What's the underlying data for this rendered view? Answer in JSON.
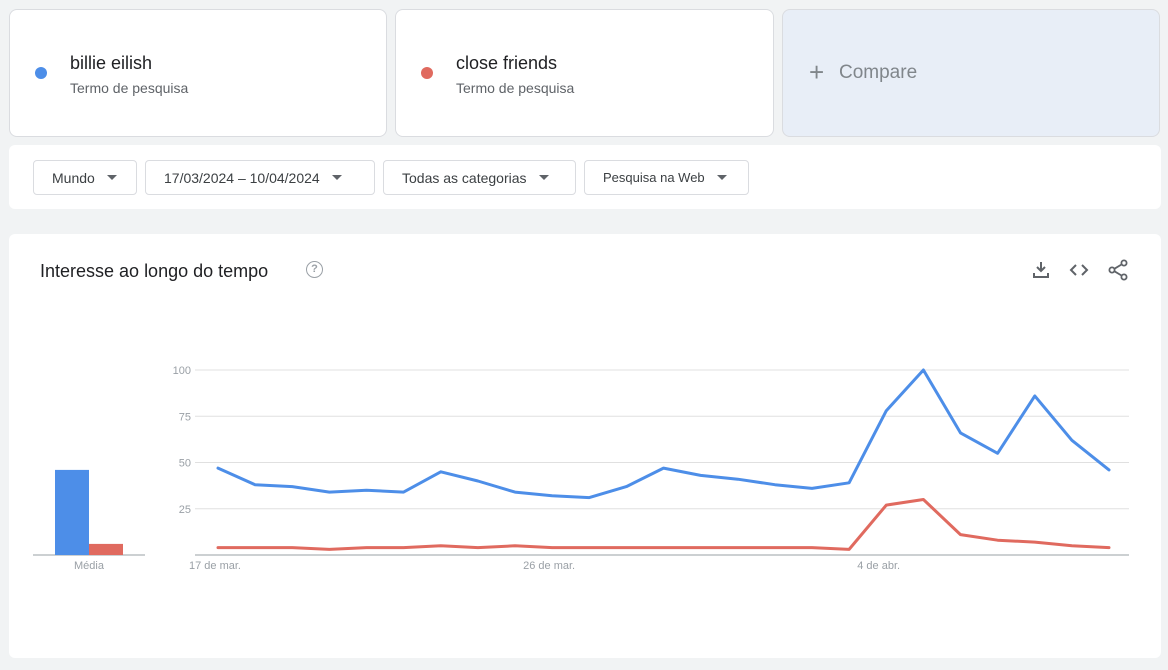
{
  "terms": [
    {
      "name": "billie eilish",
      "subtitle": "Termo de pesquisa",
      "color": "#4d8ee8"
    },
    {
      "name": "close friends",
      "subtitle": "Termo de pesquisa",
      "color": "#e06a5f"
    }
  ],
  "compare": {
    "icon": "+",
    "label": "Compare"
  },
  "filters": {
    "region": "Mundo",
    "date_range": "17/03/2024 – 10/04/2024",
    "category": "Todas as categorias",
    "search_type": "Pesquisa na Web"
  },
  "panel": {
    "title": "Interesse ao longo do tempo",
    "help_icon": "?",
    "actions": [
      "download-icon",
      "embed-icon",
      "share-icon"
    ]
  },
  "chart_data": {
    "type": "line",
    "x": [
      "17 de mar.",
      "18 de mar.",
      "19 de mar.",
      "20 de mar.",
      "21 de mar.",
      "22 de mar.",
      "23 de mar.",
      "24 de mar.",
      "25 de mar.",
      "26 de mar.",
      "27 de mar.",
      "28 de mar.",
      "29 de mar.",
      "30 de mar.",
      "31 de mar.",
      "1 de abr.",
      "2 de abr.",
      "3 de abr.",
      "4 de abr.",
      "5 de abr.",
      "6 de abr.",
      "7 de abr.",
      "8 de abr.",
      "9 de abr.",
      "10 de abr."
    ],
    "x_tick_labels": [
      "17 de mar.",
      "26 de mar.",
      "4 de abr."
    ],
    "x_tick_indices": [
      0,
      9,
      18
    ],
    "series": [
      {
        "name": "billie eilish",
        "color": "#4d8ee8",
        "values": [
          47,
          38,
          37,
          34,
          35,
          34,
          45,
          40,
          34,
          32,
          31,
          37,
          47,
          43,
          41,
          38,
          36,
          39,
          78,
          100,
          66,
          55,
          86,
          62,
          46
        ]
      },
      {
        "name": "close friends",
        "color": "#e06a5f",
        "values": [
          4,
          4,
          4,
          3,
          4,
          4,
          5,
          4,
          5,
          4,
          4,
          4,
          4,
          4,
          4,
          4,
          4,
          3,
          27,
          30,
          11,
          8,
          7,
          5,
          4
        ]
      }
    ],
    "y_ticks": [
      25,
      50,
      75,
      100
    ],
    "ylim": [
      0,
      100
    ],
    "grid": true,
    "average": {
      "label": "Média",
      "values": [
        {
          "series": "billie eilish",
          "value": 46
        },
        {
          "series": "close friends",
          "value": 6
        }
      ]
    }
  }
}
